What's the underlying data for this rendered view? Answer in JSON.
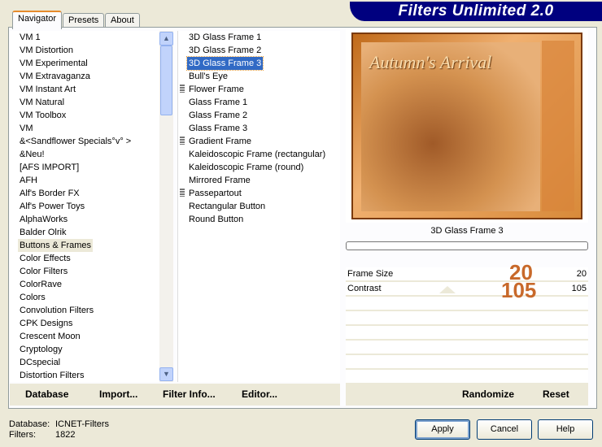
{
  "title": "Filters Unlimited 2.0",
  "tabs": [
    {
      "label": "Navigator"
    },
    {
      "label": "Presets"
    },
    {
      "label": "About"
    }
  ],
  "categories": [
    "VM 1",
    "VM Distortion",
    "VM Experimental",
    "VM Extravaganza",
    "VM Instant Art",
    "VM Natural",
    "VM Toolbox",
    "VM",
    "&<Sandflower Specials°v° >",
    "&Neu!",
    "[AFS IMPORT]",
    "AFH",
    "Alf's Border FX",
    "Alf's Power Toys",
    "AlphaWorks",
    "Balder Olrik",
    "Buttons & Frames",
    "Color Effects",
    "Color Filters",
    "ColorRave",
    "Colors",
    "Convolution Filters",
    "CPK Designs",
    "Crescent Moon",
    "Cryptology",
    "DCspecial",
    "Distortion Filters"
  ],
  "selected_category": "Buttons & Frames",
  "filters": [
    {
      "label": "3D Glass Frame 1"
    },
    {
      "label": "3D Glass Frame 2"
    },
    {
      "label": "3D Glass Frame 3",
      "selected": true
    },
    {
      "label": "Bull's Eye"
    },
    {
      "label": "Flower Frame",
      "grip": true
    },
    {
      "label": "Glass Frame 1"
    },
    {
      "label": "Glass Frame 2"
    },
    {
      "label": "Glass Frame 3"
    },
    {
      "label": "Gradient Frame",
      "grip": true
    },
    {
      "label": "Kaleidoscopic Frame (rectangular)"
    },
    {
      "label": "Kaleidoscopic Frame (round)"
    },
    {
      "label": "Mirrored Frame"
    },
    {
      "label": "Passepartout",
      "grip": true
    },
    {
      "label": "Rectangular Button"
    },
    {
      "label": "Round Button"
    }
  ],
  "preview": {
    "image_text": "Autumn's Arrival",
    "filter_name": "3D Glass Frame 3",
    "progress": 0
  },
  "params": [
    {
      "label": "Frame Size",
      "value": "20",
      "annotation": "20"
    },
    {
      "label": "Contrast",
      "value": "105",
      "annotation": "105"
    }
  ],
  "buttons": {
    "database": "Database",
    "import": "Import...",
    "filter_info": "Filter Info...",
    "editor": "Editor...",
    "randomize": "Randomize",
    "reset": "Reset",
    "apply": "Apply",
    "cancel": "Cancel",
    "help": "Help"
  },
  "status": {
    "database_label": "Database:",
    "database_value": "ICNET-Filters",
    "filters_label": "Filters:",
    "filters_value": "1822"
  },
  "colors": {
    "title_bg": "#00007f",
    "selection": "#316ac5",
    "annotation": "#c8692a"
  }
}
